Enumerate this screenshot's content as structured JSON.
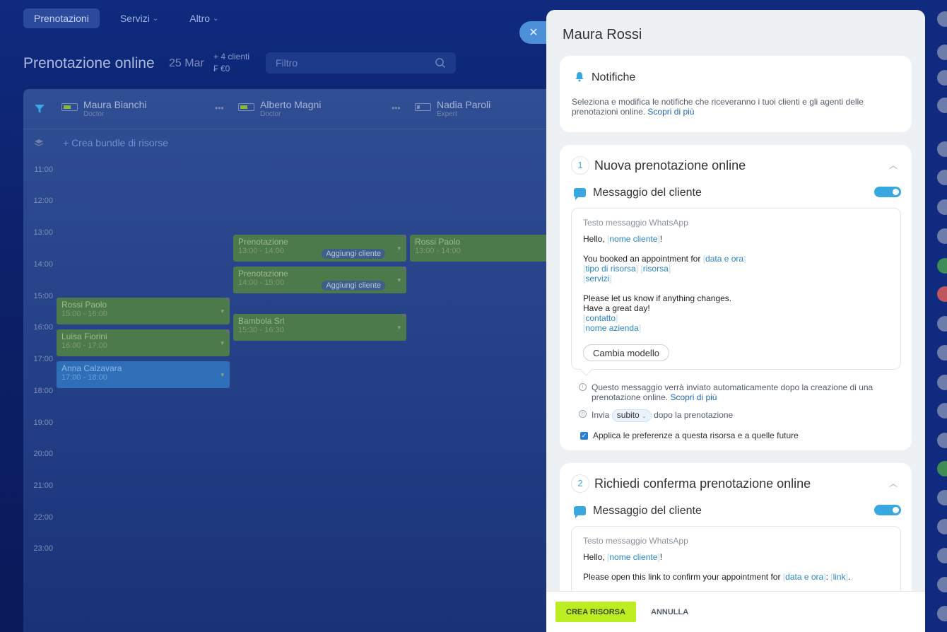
{
  "nav": {
    "tabs": [
      "Prenotazioni",
      "Servizi",
      "Altro"
    ]
  },
  "page": {
    "title": "Prenotazione online",
    "date": "25 Mar",
    "clients": "+ 4 clienti",
    "amount": "₣ €0",
    "filter_placeholder": "Filtro"
  },
  "calendar": {
    "resources": [
      {
        "name": "Maura Bianchi",
        "role": "Doctor"
      },
      {
        "name": "Alberto Magni",
        "role": "Doctor"
      },
      {
        "name": "Nadia Paroli",
        "role": "Expert"
      }
    ],
    "bundle_link": "+ Crea bundle di risorse",
    "hours": [
      "11:00",
      "12:00",
      "13:00",
      "14:00",
      "15:00",
      "16:00",
      "17:00",
      "18:00",
      "19:00",
      "20:00",
      "21:00",
      "22:00",
      "23:00"
    ],
    "events": [
      {
        "title": "Prenotazione",
        "time": "13:00 - 14:00",
        "tag": "Aggiungi cliente"
      },
      {
        "title": "Prenotazione",
        "time": "14:00 - 15:00",
        "tag": "Aggiungi cliente"
      },
      {
        "title": "Rossi Paolo",
        "time": "13:00 - 14:00"
      },
      {
        "title": "Rossi Paolo",
        "time": "15:00 - 16:00"
      },
      {
        "title": "Luisa Fiorini",
        "time": "16:00 - 17:00"
      },
      {
        "title": "Anna Calzavara",
        "time": "17:00 - 18:00"
      },
      {
        "title": "Bambola Srl",
        "time": "15:30 - 16:30"
      }
    ]
  },
  "slider": {
    "title": "Maura Rossi",
    "notifications": {
      "title": "Notifiche",
      "desc": "Seleziona e modifica le notifiche che riceveranno i tuoi clienti e gli agenti delle prenotazioni online.",
      "link": "Scopri di più"
    },
    "sections": [
      {
        "number": "1",
        "title": "Nuova prenotazione online",
        "msg_title": "Messaggio del cliente",
        "template_label": "Testo messaggio WhatsApp",
        "lines": {
          "hello": "Hello,",
          "tok_client": "nome cliente",
          "booked": "You booked an appointment for",
          "tok_date": "data e ora",
          "tok_type": "tipo di risorsa",
          "tok_resource": "risorsa",
          "tok_services": "servizi",
          "please": "Please let us know if anything changes.",
          "great": "Have a great day!",
          "tok_contact": "contatto",
          "tok_company": "nome azienda"
        },
        "change_button": "Cambia modello",
        "info_text": "Questo messaggio verrà inviato automaticamente dopo la creazione di una prenotazione online.",
        "info_link": "Scopri di più",
        "send_prefix": "Invia",
        "send_value": "subito",
        "send_suffix": "dopo la prenotazione",
        "checkbox_label": "Applica le preferenze a questa risorsa e a quelle future"
      },
      {
        "number": "2",
        "title": "Richiedi conferma prenotazione online",
        "msg_title": "Messaggio del cliente",
        "template_label": "Testo messaggio WhatsApp",
        "lines": {
          "hello": "Hello,",
          "tok_client": "nome cliente",
          "open": "Please open this link to confirm your appointment for",
          "tok_date": "data e ora",
          "tok_link": "link"
        }
      }
    ],
    "footer": {
      "create": "CREA RISORSA",
      "cancel": "ANNULLA"
    }
  },
  "colors": {
    "accent": "#3aa8e0",
    "create_button": "#bbed21",
    "event_green": "#4d7a4a",
    "event_blue": "#2f6fb8"
  }
}
